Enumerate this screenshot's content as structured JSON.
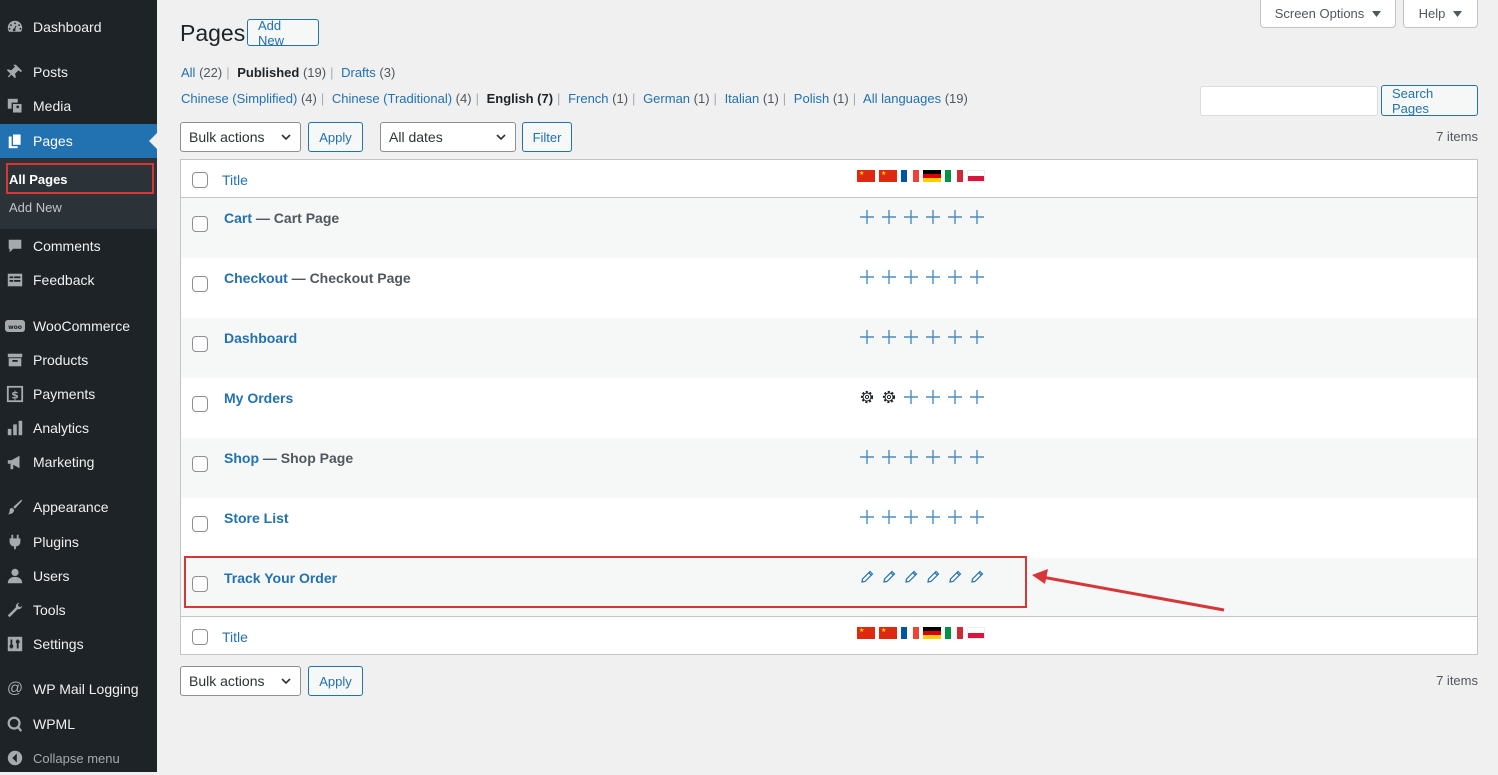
{
  "sidebar": {
    "items": [
      {
        "label": "Dashboard",
        "icon": "dashboard-icon"
      },
      {
        "label": "Posts",
        "icon": "pin-icon"
      },
      {
        "label": "Media",
        "icon": "media-icon"
      },
      {
        "label": "Pages",
        "icon": "pages-icon",
        "active": true
      },
      {
        "label": "Comments",
        "icon": "comment-icon"
      },
      {
        "label": "Feedback",
        "icon": "feedback-icon"
      },
      {
        "label": "WooCommerce",
        "icon": "woo-icon"
      },
      {
        "label": "Products",
        "icon": "archive-icon"
      },
      {
        "label": "Payments",
        "icon": "dollar-icon"
      },
      {
        "label": "Analytics",
        "icon": "chart-icon"
      },
      {
        "label": "Marketing",
        "icon": "megaphone-icon"
      },
      {
        "label": "Appearance",
        "icon": "brush-icon"
      },
      {
        "label": "Plugins",
        "icon": "plugin-icon"
      },
      {
        "label": "Users",
        "icon": "user-icon"
      },
      {
        "label": "Tools",
        "icon": "wrench-icon"
      },
      {
        "label": "Settings",
        "icon": "settings-icon"
      },
      {
        "label": "WP Mail Logging",
        "icon": "at-icon"
      },
      {
        "label": "WPML",
        "icon": "wpml-icon"
      },
      {
        "label": "Collapse menu",
        "icon": "collapse-icon"
      }
    ],
    "submenu": {
      "all_pages": "All Pages",
      "add_new": "Add New"
    }
  },
  "header": {
    "screen_options": "Screen Options",
    "help": "Help",
    "title": "Pages",
    "add_new": "Add New"
  },
  "status_filters": {
    "all": "All",
    "all_count": "(22)",
    "published": "Published",
    "published_count": "(19)",
    "drafts": "Drafts",
    "drafts_count": "(3)"
  },
  "language_filters": {
    "zh_s": "Chinese (Simplified)",
    "zh_s_count": "(4)",
    "zh_t": "Chinese (Traditional)",
    "zh_t_count": "(4)",
    "en": "English",
    "en_count": "(7)",
    "fr": "French",
    "fr_count": "(1)",
    "de": "German",
    "de_count": "(1)",
    "it": "Italian",
    "it_count": "(1)",
    "pl": "Polish",
    "pl_count": "(1)",
    "all": "All languages",
    "all_count": "(19)"
  },
  "toolbar": {
    "bulk_actions": "Bulk actions",
    "apply": "Apply",
    "all_dates": "All dates",
    "filter": "Filter",
    "search_button": "Search Pages",
    "search_value": "",
    "items_count": "7 items"
  },
  "table": {
    "column_title": "Title",
    "flags": [
      "cn",
      "tw",
      "fr",
      "de",
      "it",
      "pl"
    ],
    "rows": [
      {
        "title": "Cart",
        "state": " — Cart Page",
        "status": [
          "add",
          "add",
          "add",
          "add",
          "add",
          "add"
        ]
      },
      {
        "title": "Checkout",
        "state": " — Checkout Page",
        "status": [
          "add",
          "add",
          "add",
          "add",
          "add",
          "add"
        ]
      },
      {
        "title": "Dashboard",
        "state": "",
        "status": [
          "add",
          "add",
          "add",
          "add",
          "add",
          "add"
        ]
      },
      {
        "title": "My Orders",
        "state": "",
        "status": [
          "gear",
          "gear",
          "add",
          "add",
          "add",
          "add"
        ]
      },
      {
        "title": "Shop",
        "state": " — Shop Page",
        "status": [
          "add",
          "add",
          "add",
          "add",
          "add",
          "add"
        ]
      },
      {
        "title": "Store List",
        "state": "",
        "status": [
          "add",
          "add",
          "add",
          "add",
          "add",
          "add"
        ]
      },
      {
        "title": "Track Your Order",
        "state": "",
        "status": [
          "edit",
          "edit",
          "edit",
          "edit",
          "edit",
          "edit"
        ]
      }
    ]
  },
  "colors": {
    "sidebar_bg": "#1d2327",
    "active": "#2271b1",
    "link": "#2271b1",
    "highlight": "#d63638"
  }
}
